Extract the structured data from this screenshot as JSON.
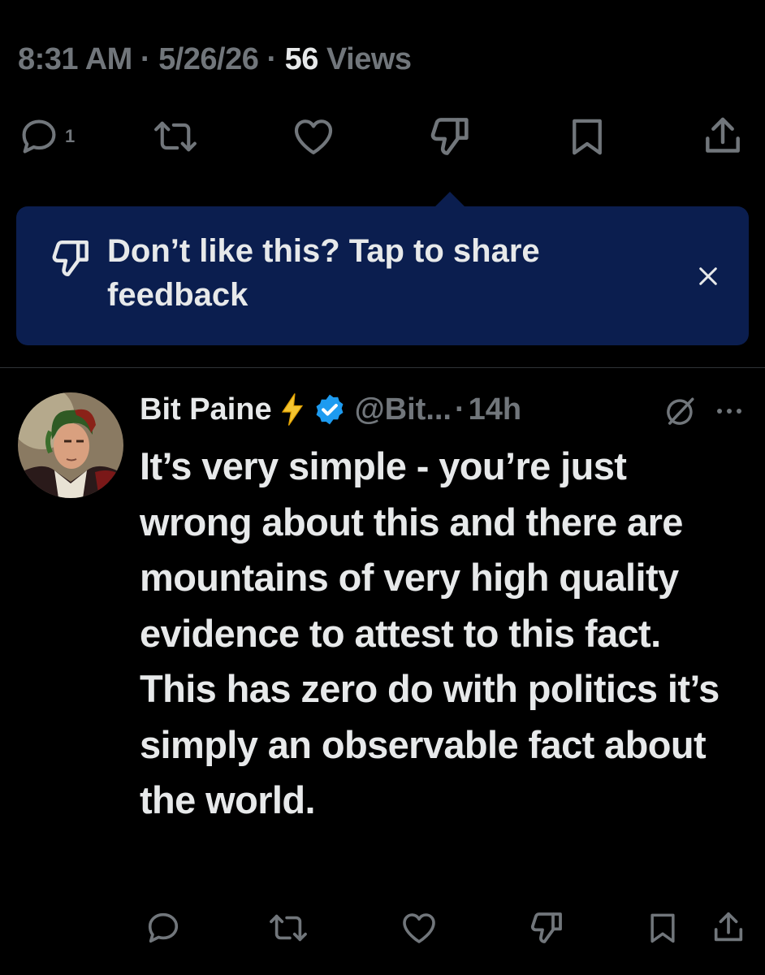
{
  "detail": {
    "time": "8:31 AM",
    "date": "5/26/26",
    "views_count": "56",
    "views_label": "Views",
    "separator": "·"
  },
  "main_actions": {
    "reply_count": "1",
    "icons": [
      "reply-icon",
      "retweet-icon",
      "like-icon",
      "dislike-icon",
      "bookmark-icon",
      "share-icon"
    ]
  },
  "feedback_prompt": {
    "text": "Don’t like this? Tap to share feedback",
    "icon": "dislike-icon",
    "close_icon": "close-icon"
  },
  "reply": {
    "display_name": "Bit Paine",
    "badge_emoji": "⚡",
    "handle": "@Bit...",
    "separator": "·",
    "time": "14h",
    "body": "It’s very simple - you’re just wrong about this and there are mountains of very high quality evidence to attest to this fact. This has zero do with politics it’s simply an observable fact about the world.",
    "icons": [
      "grok-icon",
      "more-icon",
      "reply-icon",
      "retweet-icon",
      "like-icon",
      "dislike-icon",
      "bookmark-icon",
      "share-icon"
    ]
  },
  "colors": {
    "background": "#000000",
    "text": "#e7e9ea",
    "muted": "#71767b",
    "feedback_bg": "#0b1e4f",
    "verified": "#1d9bf0",
    "lightning": "#f4c430"
  }
}
